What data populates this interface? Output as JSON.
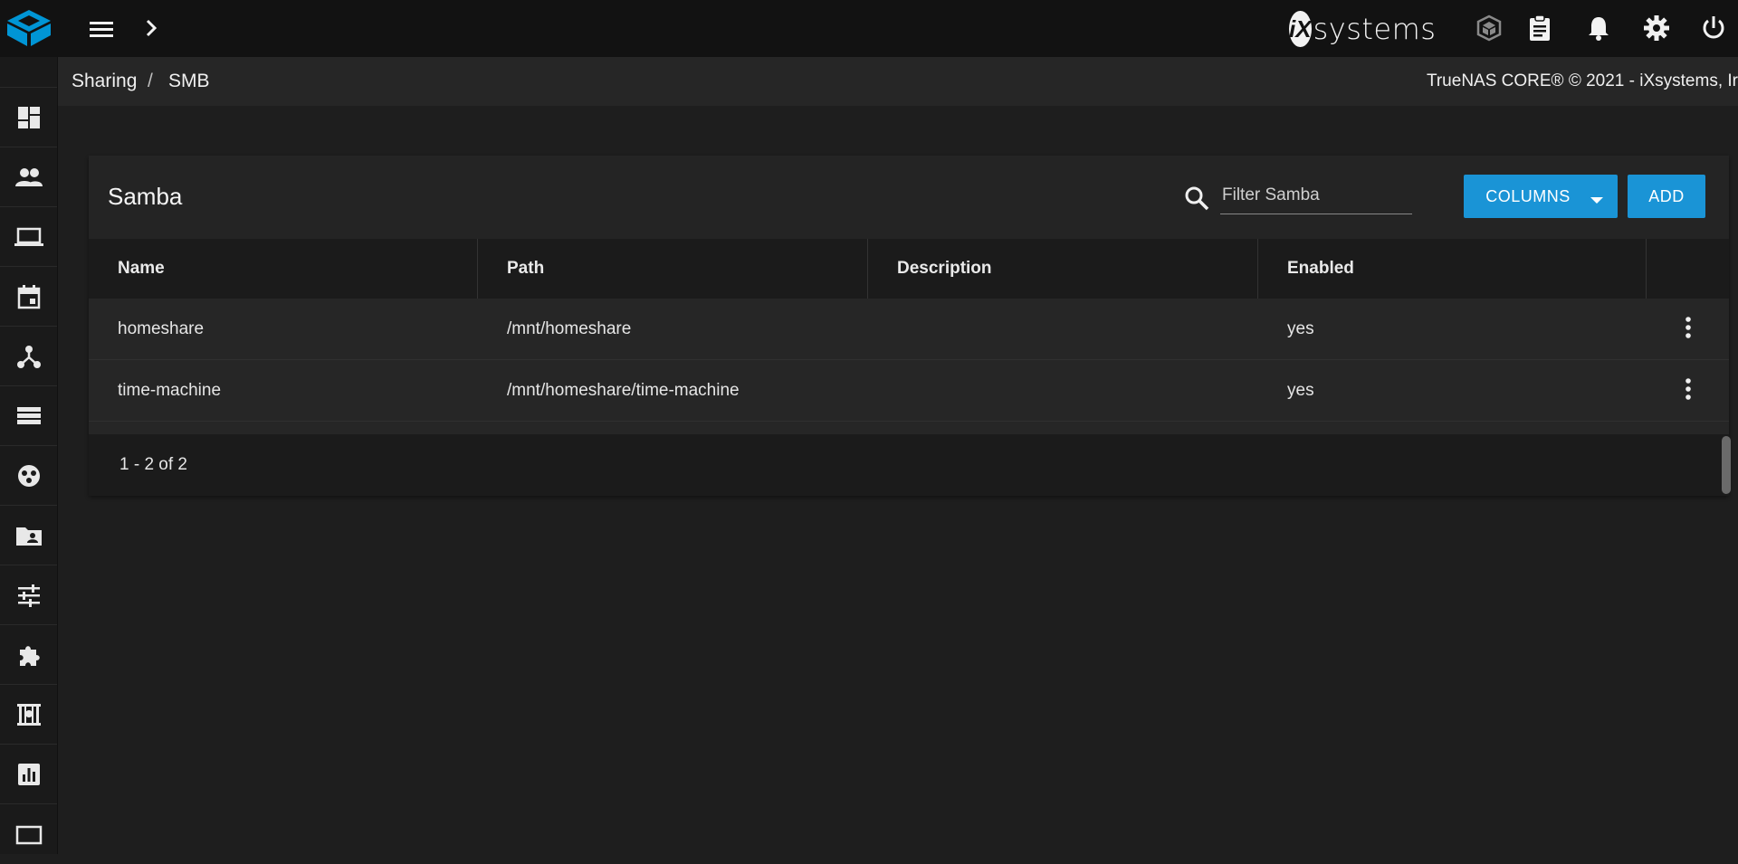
{
  "topbar": {
    "brand_text": "systems",
    "brand_mark": "iX",
    "icons": [
      "truenas-logo-icon",
      "menu-icon",
      "chevron-right-icon",
      "truecommand-icon",
      "clipboard-icon",
      "bell-icon",
      "gear-icon",
      "power-icon"
    ]
  },
  "breadcrumb": {
    "items": [
      "Sharing",
      "SMB"
    ],
    "separator": "/",
    "copyright": "TrueNAS CORE® © 2021 - iXsystems, Ir"
  },
  "sidebar": {
    "items": [
      "dashboard-icon",
      "accounts-icon",
      "system-icon",
      "tasks-icon",
      "network-icon",
      "storage-icon",
      "directory-services-icon",
      "sharing-icon",
      "services-icon",
      "plugins-icon",
      "jails-icon",
      "reporting-icon",
      "virtual-machines-icon"
    ]
  },
  "card": {
    "title": "Samba",
    "filter_placeholder": "Filter Samba",
    "columns_label": "COLUMNS",
    "add_label": "ADD"
  },
  "table": {
    "headers": [
      "Name",
      "Path",
      "Description",
      "Enabled"
    ],
    "rows": [
      {
        "name": "homeshare",
        "path": "/mnt/homeshare",
        "description": "",
        "enabled": "yes"
      },
      {
        "name": "time-machine",
        "path": "/mnt/homeshare/time-machine",
        "description": "",
        "enabled": "yes"
      }
    ],
    "pager": "1 - 2 of 2"
  },
  "colors": {
    "accent": "#1a94d6",
    "logo": "#0095d5",
    "background": "#1e1e1e",
    "topbar": "#121212"
  }
}
